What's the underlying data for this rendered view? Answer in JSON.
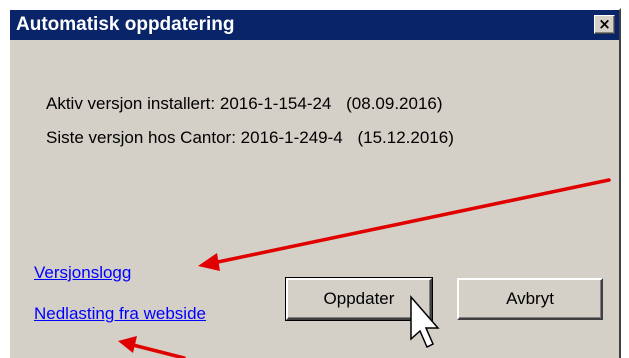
{
  "window": {
    "title": "Automatisk oppdatering",
    "close_glyph": "×"
  },
  "info": {
    "installed_label": "Aktiv versjon installert:",
    "installed_version": "2016-1-154-24",
    "installed_date": "(08.09.2016)",
    "latest_label": "Siste versjon hos Cantor:",
    "latest_version": "2016-1-249-4",
    "latest_date": "(15.12.2016)"
  },
  "links": {
    "version_log": "Versjonslogg",
    "download": "Nedlasting fra webside"
  },
  "buttons": {
    "update": "Oppdater",
    "cancel": "Avbryt"
  },
  "colors": {
    "titlebar": "#0a246a",
    "dialog_face": "#d4d0c8",
    "link": "#0000ff",
    "annotation_arrow": "#e00000"
  },
  "icons": {
    "close": "close-icon",
    "cursor": "mouse-pointer-icon",
    "annotation": "arrow-icon"
  }
}
